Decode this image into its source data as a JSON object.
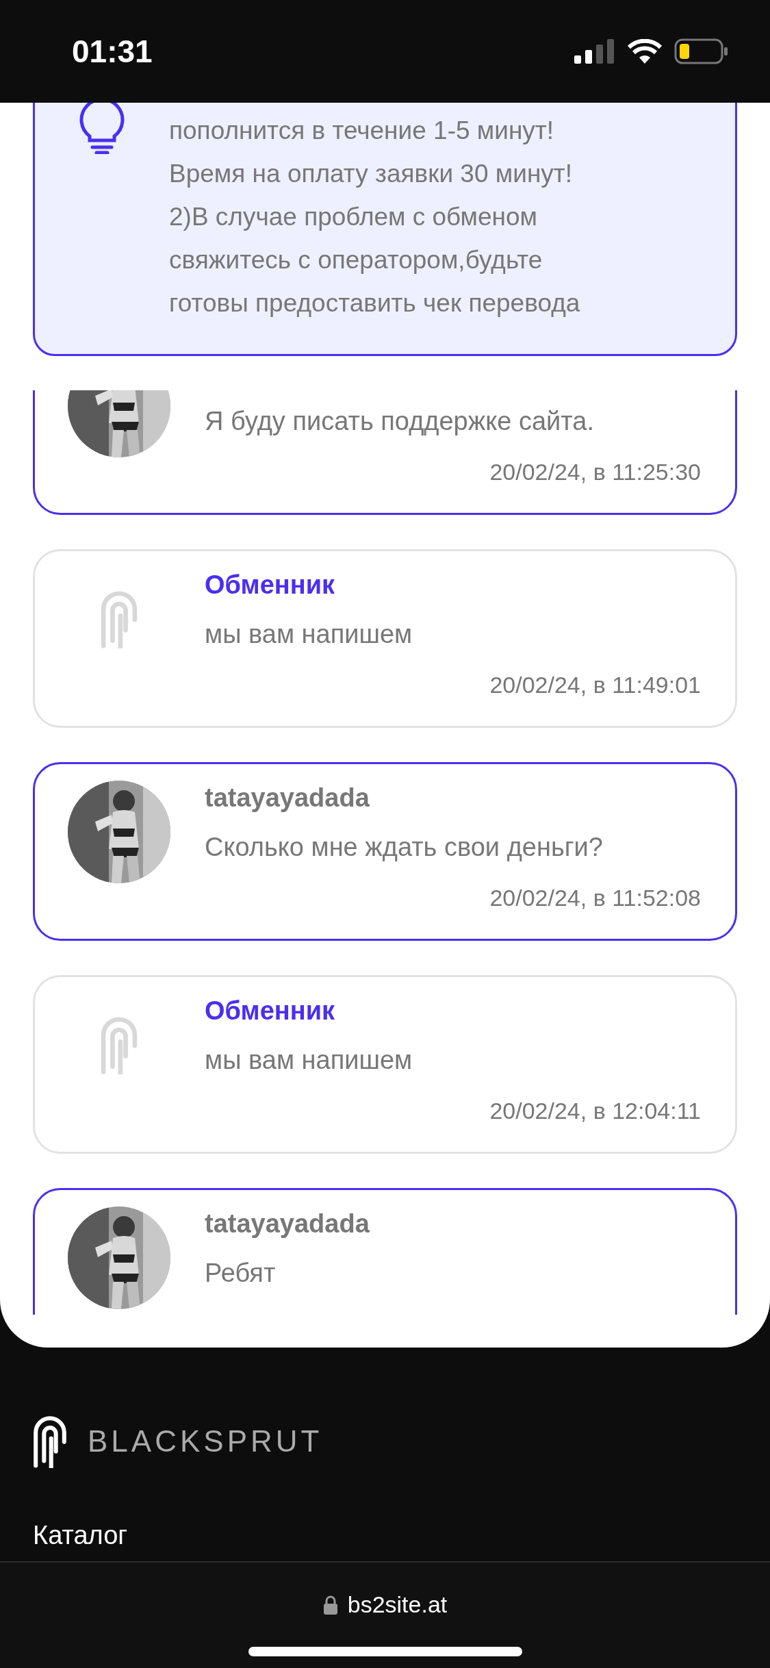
{
  "status_bar": {
    "time": "01:31"
  },
  "notice": {
    "text": "пополнится в течение 1-5 минут!\nВремя на оплату заявки 30 минут!\n2)В случае проблем с обменом\nсвяжитесь с оператором,будьте\nготовы предоставить чек перевода"
  },
  "messages": [
    {
      "kind": "user",
      "text": "Я буду писать поддержке сайта.",
      "time": "20/02/24, в 11:25:30"
    },
    {
      "kind": "exchanger",
      "author": "Обменник",
      "text": "мы вам напишем",
      "time": "20/02/24, в 11:49:01"
    },
    {
      "kind": "user",
      "author": "tatayayadada",
      "text": "Сколько мне ждать свои деньги?",
      "time": "20/02/24, в 11:52:08"
    },
    {
      "kind": "exchanger",
      "author": "Обменник",
      "text": "мы вам напишем",
      "time": "20/02/24, в 12:04:11"
    },
    {
      "kind": "user",
      "author": "tatayayadada",
      "text": "Ребят"
    }
  ],
  "footer": {
    "brand": "BLACKSPRUT",
    "links": [
      "Каталог"
    ]
  },
  "browser": {
    "url": "bs2site.at"
  }
}
